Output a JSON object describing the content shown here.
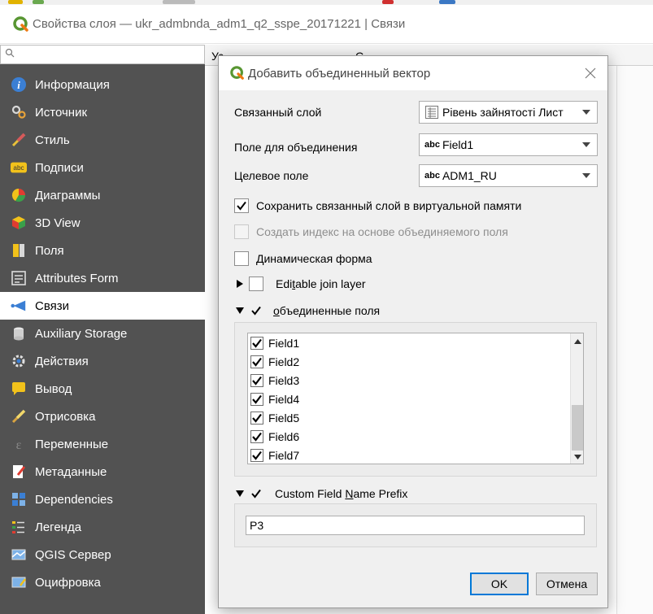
{
  "main_window": {
    "title": "Свойства слоя — ukr_admbnda_adm1_q2_sspe_20171221 | Связи"
  },
  "search": {
    "placeholder": ""
  },
  "nav": {
    "items": [
      {
        "label": "Информация",
        "icon": "info-icon"
      },
      {
        "label": "Источник",
        "icon": "source-icon"
      },
      {
        "label": "Стиль",
        "icon": "style-brush-icon"
      },
      {
        "label": "Подписи",
        "icon": "labels-abc-icon"
      },
      {
        "label": "Диаграммы",
        "icon": "diagrams-icon"
      },
      {
        "label": "3D View",
        "icon": "cube-3d-icon"
      },
      {
        "label": "Поля",
        "icon": "fields-icon"
      },
      {
        "label": "Attributes Form",
        "icon": "form-icon"
      },
      {
        "label": "Связи",
        "icon": "joins-icon"
      },
      {
        "label": "Auxiliary Storage",
        "icon": "storage-icon"
      },
      {
        "label": "Действия",
        "icon": "actions-gear-icon"
      },
      {
        "label": "Вывод",
        "icon": "display-speech-icon"
      },
      {
        "label": "Отрисовка",
        "icon": "rendering-brush-icon"
      },
      {
        "label": "Переменные",
        "icon": "variables-icon"
      },
      {
        "label": "Метаданные",
        "icon": "metadata-icon"
      },
      {
        "label": "Dependencies",
        "icon": "dependencies-icon"
      },
      {
        "label": "Легенда",
        "icon": "legend-icon"
      },
      {
        "label": "QGIS Сервер",
        "icon": "server-icon"
      },
      {
        "label": "Оцифровка",
        "icon": "digitizing-icon"
      }
    ],
    "active_index": 8
  },
  "right_panel": {
    "col1": "Ус",
    "col2": "С"
  },
  "dialog": {
    "title": "Добавить объединенный вектор",
    "join_layer_label": "Связанный слой",
    "join_layer_value": "Рівень зайнятості Лист",
    "join_field_label": "Поле для объединения",
    "join_field_abc": "abc",
    "join_field_value": "Field1",
    "target_field_label": "Целевое поле",
    "target_field_abc": "abc",
    "target_field_value": "ADM1_RU",
    "cache_label": "Сохранить связанный слой в виртуальной памяти",
    "cache_checked": true,
    "index_label": "Создать индекс на основе объединяемого поля",
    "dynamic_form_label": "Динамическая форма",
    "editable_prefix": "Edi",
    "editable_mnemonic": "t",
    "editable_suffix": "able join layer",
    "joined_fields_mnemonic": "о",
    "joined_fields_suffix": "бъединенные поля",
    "fields": [
      "Field1",
      "Field2",
      "Field3",
      "Field4",
      "Field5",
      "Field6",
      "Field7"
    ],
    "prefix_pre": "Custom Field ",
    "prefix_mnemonic": "N",
    "prefix_post": "ame Prefix",
    "prefix_value": "P3",
    "ok_label": "OK",
    "cancel_label": "Отмена"
  },
  "colors": {
    "sidebar_bg": "#525252",
    "dialog_bg": "#f0f0f0",
    "accent": "#0078d7",
    "qgis_green": "#589632"
  }
}
